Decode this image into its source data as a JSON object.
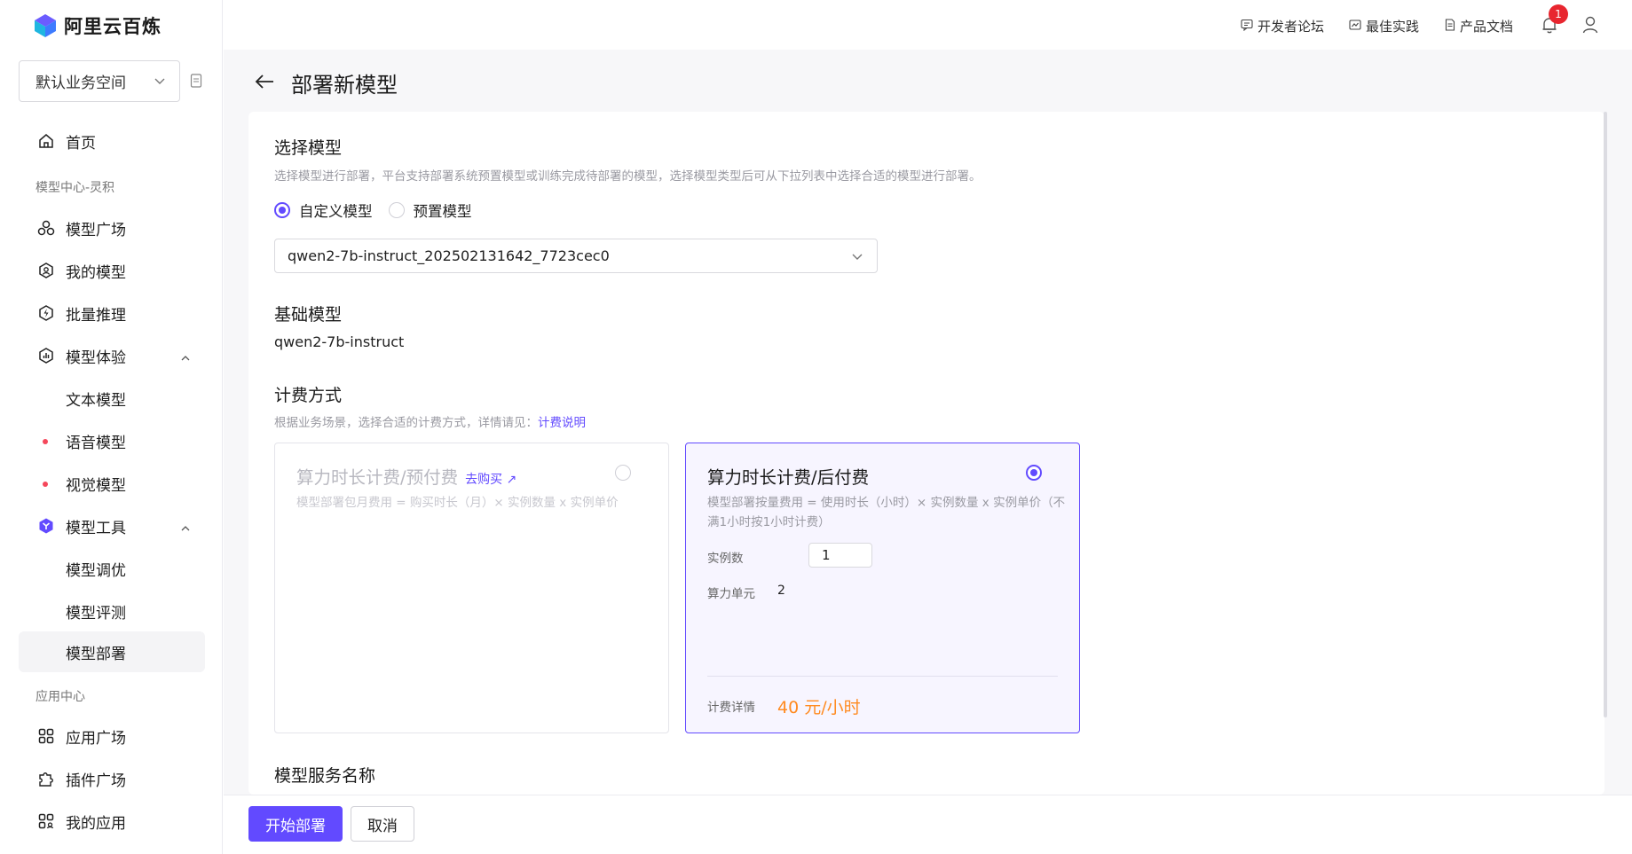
{
  "app": {
    "name": "阿里云百炼"
  },
  "topbar": {
    "links": [
      "开发者论坛",
      "最佳实践",
      "产品文档"
    ],
    "notification_count": "1"
  },
  "sidebar": {
    "workspace": "默认业务空间",
    "home": "首页",
    "group_model_center": "模型中心-灵积",
    "model_square": "模型广场",
    "my_models": "我的模型",
    "batch_inference": "批量推理",
    "model_experience": "模型体验",
    "text_model": "文本模型",
    "voice_model": "语音模型",
    "vision_model": "视觉模型",
    "model_tools": "模型工具",
    "model_tuning": "模型调优",
    "model_evaluation": "模型评测",
    "model_deploy": "模型部署",
    "group_app_center": "应用中心",
    "app_square": "应用广场",
    "plugin_square": "插件广场",
    "my_apps": "我的应用"
  },
  "page": {
    "title": "部署新模型",
    "select_model": {
      "title": "选择模型",
      "desc": "选择模型进行部署，平台支持部署系统预置模型或训练完成待部署的模型，选择模型类型后可从下拉列表中选择合适的模型进行部署。",
      "option_custom": "自定义模型",
      "option_preset": "预置模型",
      "selected_value": "qwen2-7b-instruct_202502131642_7723cec0"
    },
    "base_model": {
      "title": "基础模型",
      "value": "qwen2-7b-instruct"
    },
    "billing": {
      "title": "计费方式",
      "desc": "根据业务场景，选择合适的计费方式，详情请见：",
      "desc_link": "计费说明",
      "prepaid": {
        "title": "算力时长计费/预付费",
        "buy_link": "去购买 ↗",
        "formula": "模型部署包月费用 = 购买时长（月）× 实例数量 x 实例单价"
      },
      "postpaid": {
        "title": "算力时长计费/后付费",
        "formula": "模型部署按量费用 = 使用时长（小时）× 实例数量 x 实例单价（不满1小时按1小时计费）",
        "instances_label": "实例数",
        "instances_value": "1",
        "compute_unit_label": "算力单元",
        "compute_unit_value": "2",
        "detail_label": "计费详情",
        "price": "40 元/小时"
      }
    },
    "service_name": {
      "title": "模型服务名称"
    }
  },
  "footer": {
    "deploy": "开始部署",
    "cancel": "取消"
  },
  "colors": {
    "accent": "#624aff",
    "price": "#ff8a1f",
    "badge": "#e8262f"
  }
}
